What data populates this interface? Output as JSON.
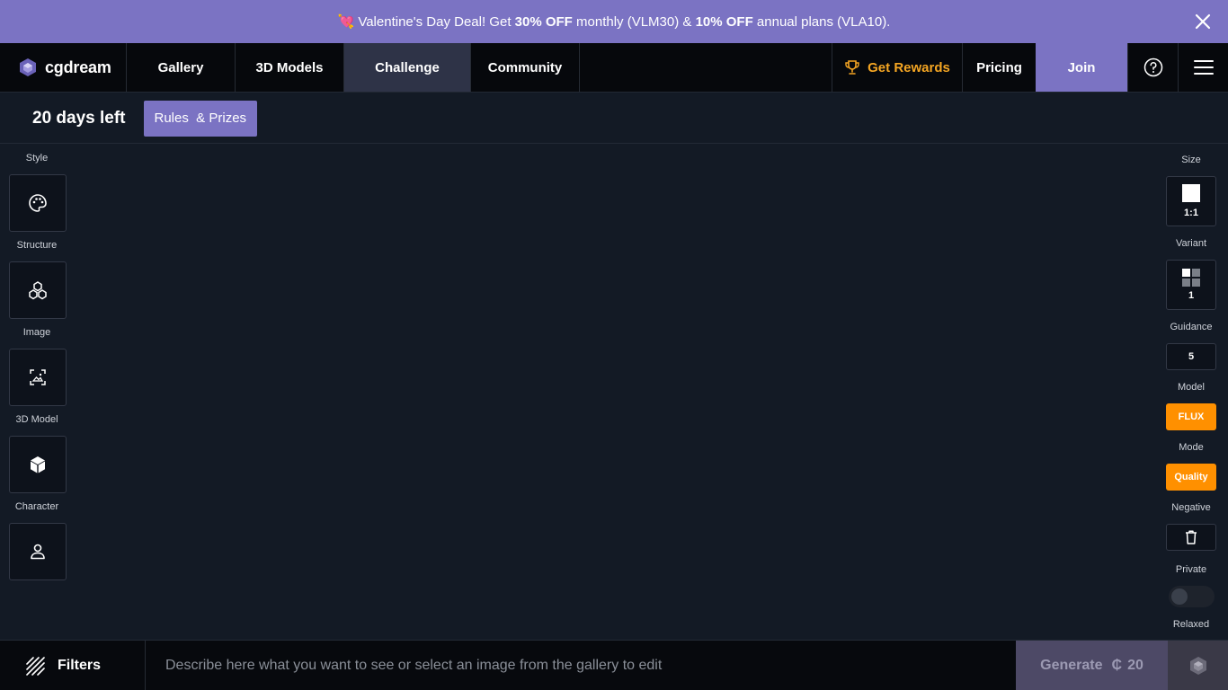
{
  "banner": {
    "emoji": "💘",
    "pre": "Valentine's Day Deal! Get ",
    "off1": "30% OFF",
    "mid": " monthly (VLM30) & ",
    "off2": "10% OFF",
    "post": " annual plans (VLA10)."
  },
  "nav": {
    "logo": "cgdream",
    "tabs": [
      {
        "label": "Gallery"
      },
      {
        "label": "3D Models"
      },
      {
        "label": "Challenge"
      },
      {
        "label": "Community"
      }
    ],
    "rewards": "Get Rewards",
    "pricing": "Pricing",
    "join": "Join"
  },
  "challenge": {
    "days_left": "20 days left",
    "rules": "Rules  & Prizes"
  },
  "left_tools": [
    {
      "label": "Style",
      "icon": "palette-icon"
    },
    {
      "label": "Structure",
      "icon": "cubes-icon"
    },
    {
      "label": "Image",
      "icon": "image-frame-icon"
    },
    {
      "label": "3D Model",
      "icon": "cube-icon"
    },
    {
      "label": "Character",
      "icon": "person-icon"
    }
  ],
  "right_tools": {
    "size_label": "Size",
    "size_value": "1:1",
    "variant_label": "Variant",
    "variant_value": "1",
    "guidance_label": "Guidance",
    "guidance_value": "5",
    "model_label": "Model",
    "model_value": "FLUX",
    "mode_label": "Mode",
    "mode_value": "Quality",
    "negative_label": "Negative",
    "private_label": "Private",
    "relaxed_label": "Relaxed"
  },
  "bottom": {
    "filters": "Filters",
    "prompt_placeholder": "Describe here what you want to see or select an image from the gallery to edit",
    "generate": "Generate",
    "cost": "20"
  },
  "colors": {
    "accent": "#7b73c3",
    "orange": "#ff9000",
    "rewards": "#f5a623"
  }
}
